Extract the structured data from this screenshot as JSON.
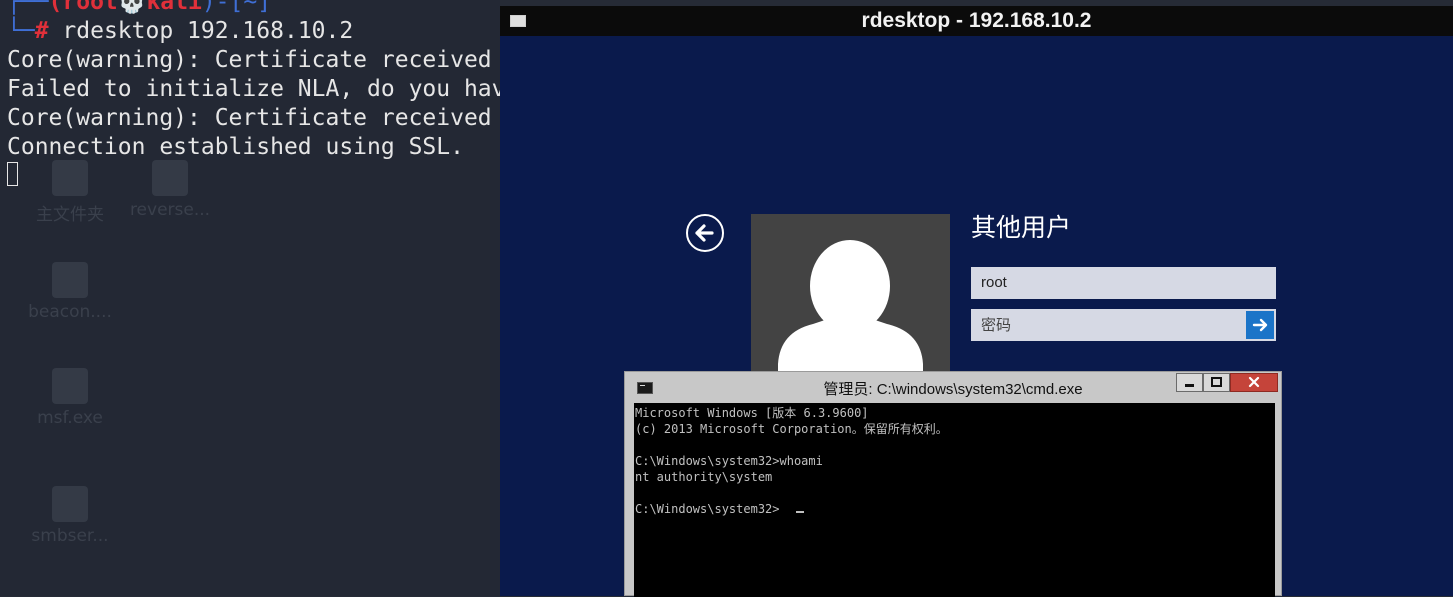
{
  "terminal": {
    "prompt_user": "(root",
    "prompt_host": "kali",
    "prompt_dir": "~",
    "prompt_hash": "#",
    "command": "rdesktop 192.168.10.2",
    "output": [
      "Core(warning): Certificate received",
      "Failed to initialize NLA, do you hav",
      "Core(warning): Certificate received",
      "Connection established using SSL."
    ]
  },
  "desktop_icons": [
    {
      "label": "主文件夹"
    },
    {
      "label": "reverse..."
    },
    {
      "label": "beacon...."
    },
    {
      "label": "msf.exe"
    },
    {
      "label": "smbser..."
    }
  ],
  "rdesktop": {
    "title": "rdesktop - 192.168.10.2",
    "login": {
      "user_label": "其他用户",
      "username_value": "root",
      "password_placeholder": "密码"
    }
  },
  "cmd": {
    "title": "管理员: C:\\windows\\system32\\cmd.exe",
    "lines": [
      "Microsoft Windows [版本 6.3.9600]",
      "(c) 2013 Microsoft Corporation。保留所有权利。",
      "",
      "C:\\Windows\\system32>whoami",
      "nt authority\\system",
      "",
      "C:\\Windows\\system32>"
    ]
  },
  "colors": {
    "rdp_bg": "#0a1a4c",
    "submit_accent": "#1b74c8",
    "close_red": "#c5443a",
    "kali_red": "#e0303a",
    "kali_blue": "#3f6fd6"
  }
}
